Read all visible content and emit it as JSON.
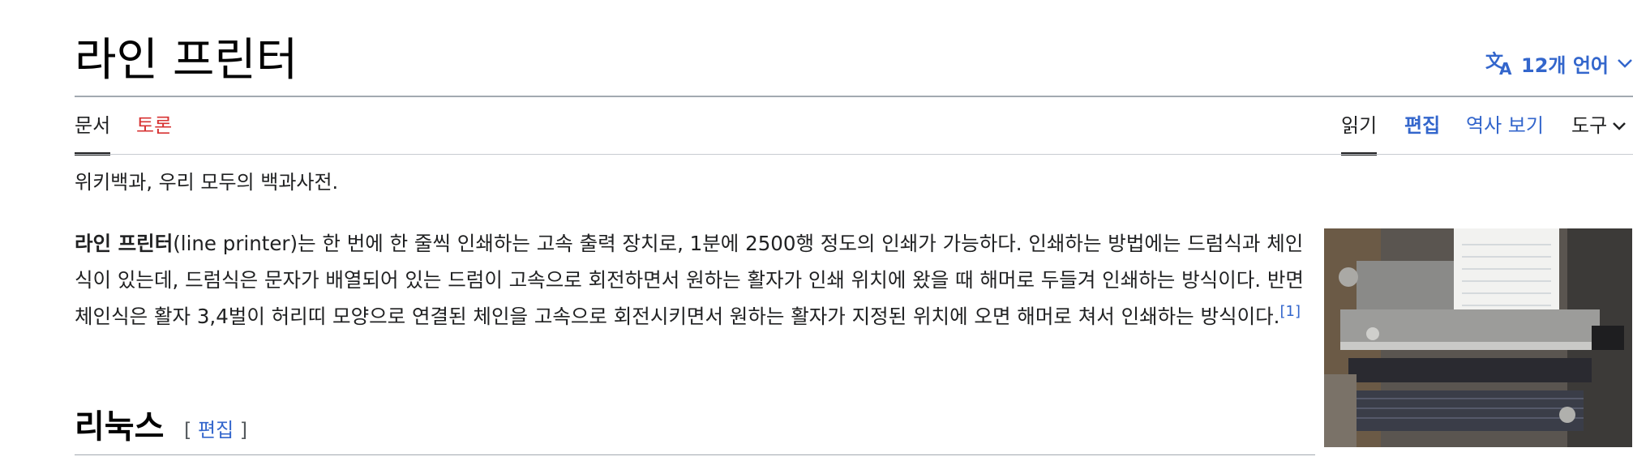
{
  "page": {
    "title": "라인 프린터",
    "tagline": "위키백과, 우리 모두의 백과사전."
  },
  "language_button": {
    "label": "12개 언어",
    "icon": "translate-icon",
    "chevron_icon": "chevron-down-icon",
    "color": "#3366cc"
  },
  "tabs": {
    "left": [
      {
        "label": "문서",
        "selected": true
      },
      {
        "label": "토론",
        "selected": false,
        "color": "#d73333"
      }
    ],
    "right": [
      {
        "label": "읽기",
        "selected": true
      },
      {
        "label": "편집",
        "selected": false
      },
      {
        "label": "역사 보기",
        "selected": false
      },
      {
        "label": "도구",
        "selected": false,
        "icon": "chevron-down-icon"
      }
    ]
  },
  "lead": {
    "term": "라인 프린터",
    "text": "(line printer)는 한 번에 한 줄씩 인쇄하는 고속 출력 장치로, 1분에 2500행 정도의 인쇄가 가능하다. 인쇄하는 방법에는 드럼식과 체인식이 있는데, 드럼식은 문자가 배열되어 있는 드럼이 고속으로 회전하면서 원하는 활자가 인쇄 위치에 왔을 때 해머로 두들겨 인쇄하는 방식이다. 반면 체인식은 활자 3,4벌이 허리띠 모양으로 연결된 체인을 고속으로 회전시키면서 원하는 활자가 지정된 위치에 오면 해머로 쳐서 인쇄하는 방식이다.",
    "reference": "[1]"
  },
  "image": {
    "subject": "line-printer-photo"
  },
  "section": {
    "title": "리눅스",
    "edit_open": "[ ",
    "edit_label": "편집",
    "edit_close": " ]"
  },
  "colors": {
    "link": "#3366cc",
    "new_link": "#d73333",
    "text": "#202122",
    "rule": "#a2a9b1"
  }
}
